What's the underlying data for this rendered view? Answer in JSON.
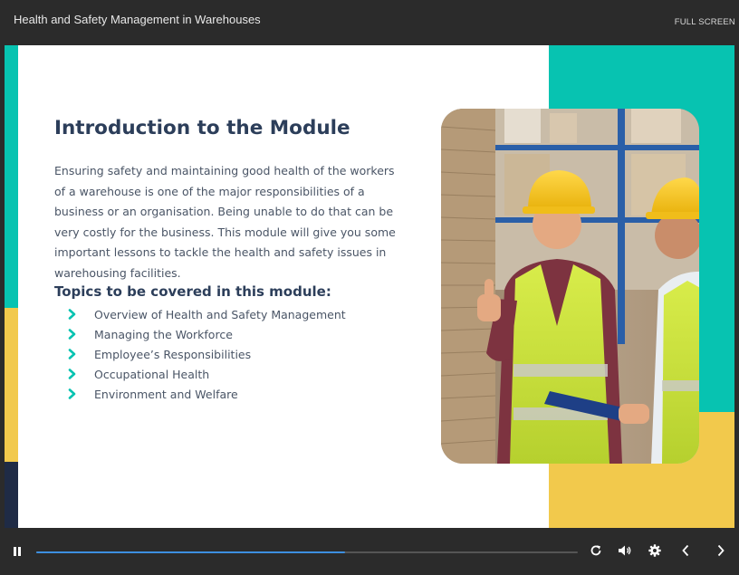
{
  "header": {
    "title": "Health and Safety Management in Warehouses",
    "fullscreen_label": "FULL SCREEN"
  },
  "slide": {
    "heading": "Introduction to the Module",
    "intro": "Ensuring safety and maintaining good health of the workers of a warehouse is one of the major responsibilities of a business or an organisation. Being unable to do that can be very costly for the business. This module will give you some important lessons to tackle the health and safety issues in warehousing facilities.",
    "topics_heading": "Topics to be covered in this module:",
    "topics": [
      "Overview of Health and Safety Management",
      "Managing the Workforce",
      "Employee’s Responsibilities",
      "Occupational Health",
      "Environment and Welfare"
    ],
    "photo_icon": "warehouse-workers-photo"
  },
  "player": {
    "progress": 0.57,
    "icons": [
      "pause-icon",
      "replay-icon",
      "volume-icon",
      "settings-icon",
      "prev-icon",
      "next-icon"
    ]
  },
  "colors": {
    "teal": "#07c3b1",
    "yellow": "#f2c94c",
    "navy": "#1f2b45",
    "heading": "#2c3e5a",
    "progress": "#3d8fe0"
  }
}
